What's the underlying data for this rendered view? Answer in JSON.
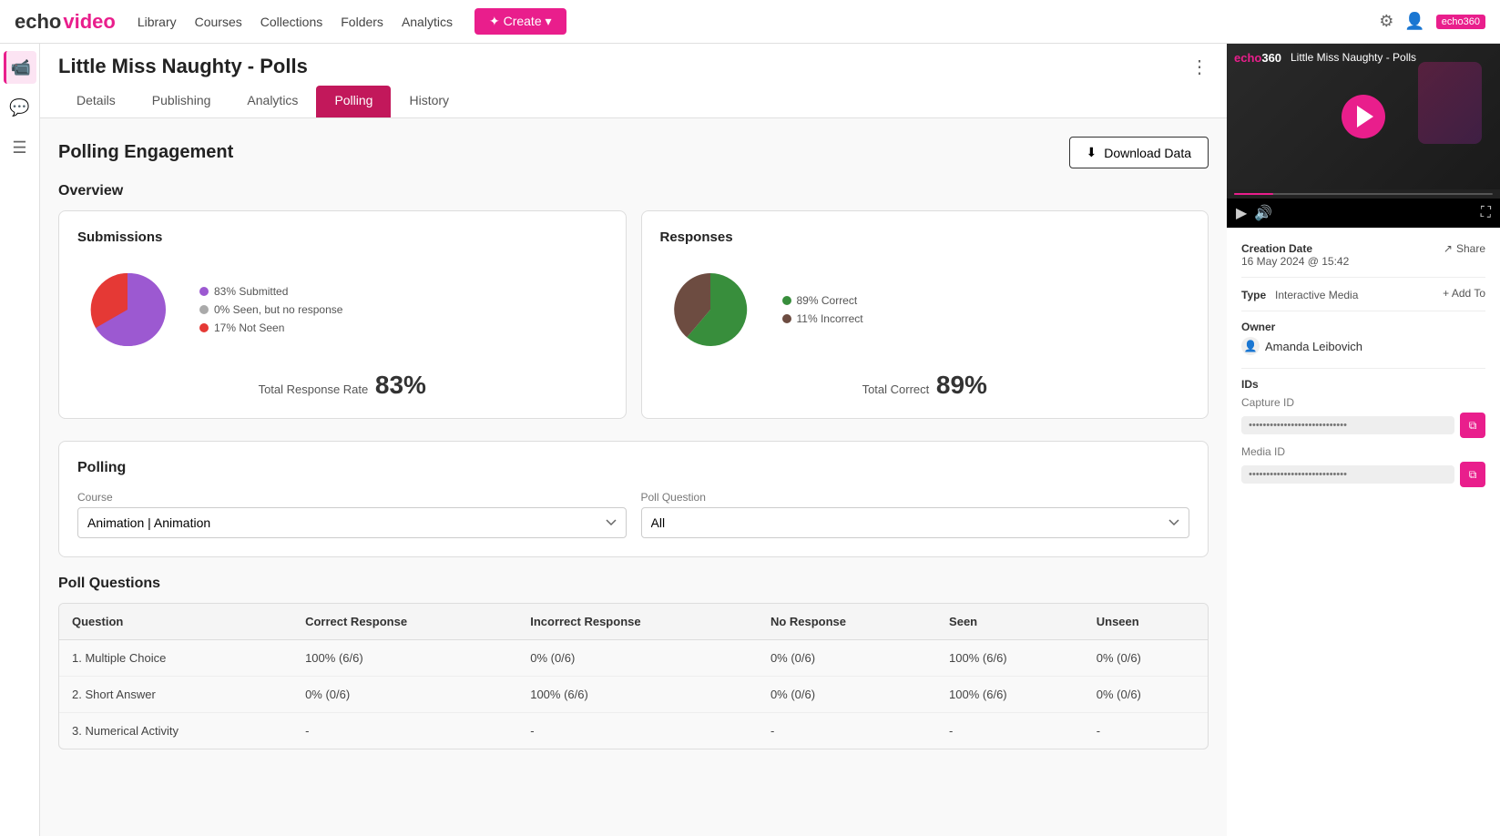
{
  "app": {
    "logo_echo": "echo",
    "logo_video": "video",
    "nav": [
      "Library",
      "Courses",
      "Collections",
      "Folders",
      "Analytics"
    ],
    "create_label": "✦ Create ▾",
    "echo360_badge": "echo360"
  },
  "page": {
    "title": "Little Miss Naughty - Polls",
    "more_icon": "⋮",
    "tabs": [
      {
        "label": "Details",
        "active": false
      },
      {
        "label": "Publishing",
        "active": false
      },
      {
        "label": "Analytics",
        "active": false
      },
      {
        "label": "Polling",
        "active": true
      },
      {
        "label": "History",
        "active": false
      }
    ]
  },
  "polling": {
    "section_title": "Polling Engagement",
    "download_label": "Download Data",
    "download_icon": "⬇",
    "overview_label": "Overview",
    "submissions": {
      "title": "Submissions",
      "submitted_pct": 83,
      "not_seen_pct": 17,
      "seen_no_response_pct": 0,
      "legend": [
        {
          "label": "83% Submitted",
          "color": "#9c59d1"
        },
        {
          "label": "0% Seen, but no response",
          "color": "#aaa"
        },
        {
          "label": "17% Not Seen",
          "color": "#e53935"
        }
      ],
      "rate_label": "Total Response Rate",
      "rate_value": "83%"
    },
    "responses": {
      "title": "Responses",
      "correct_pct": 89,
      "incorrect_pct": 11,
      "legend": [
        {
          "label": "89% Correct",
          "color": "#388e3c"
        },
        {
          "label": "11% Incorrect",
          "color": "#6d4c41"
        }
      ],
      "rate_label": "Total Correct",
      "rate_value": "89%"
    },
    "polling_section_title": "Polling",
    "course_label": "Course",
    "course_value": "Animation | Animation",
    "poll_question_label": "Poll Question",
    "poll_question_value": "All",
    "poll_questions_title": "Poll Questions",
    "table_headers": [
      "Question",
      "Correct Response",
      "Incorrect Response",
      "No Response",
      "Seen",
      "Unseen"
    ],
    "table_rows": [
      {
        "question": "1. Multiple Choice",
        "correct": "100% (6/6)",
        "incorrect": "0% (0/6)",
        "no_response": "0% (0/6)",
        "seen": "100% (6/6)",
        "unseen": "0% (0/6)"
      },
      {
        "question": "2. Short Answer",
        "correct": "0% (0/6)",
        "incorrect": "100% (6/6)",
        "no_response": "0% (0/6)",
        "seen": "100% (6/6)",
        "unseen": "0% (0/6)"
      },
      {
        "question": "3. Numerical Activity",
        "correct": "-",
        "incorrect": "-",
        "no_response": "-",
        "seen": "-",
        "unseen": "-"
      }
    ]
  },
  "right_panel": {
    "video_title": "Little Miss Naughty - Polls",
    "echo360_label_e": "echo",
    "echo360_label_rest": "360",
    "creation_date_label": "Creation Date",
    "creation_date_value": "16 May 2024 @ 15:42",
    "share_label": "Share",
    "type_label": "Type",
    "type_value": "Interactive Media",
    "add_to_label": "+ Add To",
    "owner_label": "Owner",
    "owner_name": "Amanda Leibovich",
    "ids_label": "IDs",
    "capture_id_label": "Capture ID",
    "media_id_label": "Media ID",
    "capture_id_placeholder": "••••••••••••••••••••••••••••",
    "media_id_placeholder": "••••••••••••••••••••••••••••"
  },
  "sidebar_icons": [
    {
      "name": "media-icon",
      "symbol": "🎬",
      "active": true
    },
    {
      "name": "chat-icon",
      "symbol": "💬",
      "active": false
    },
    {
      "name": "list-icon",
      "symbol": "☰",
      "active": false
    }
  ]
}
